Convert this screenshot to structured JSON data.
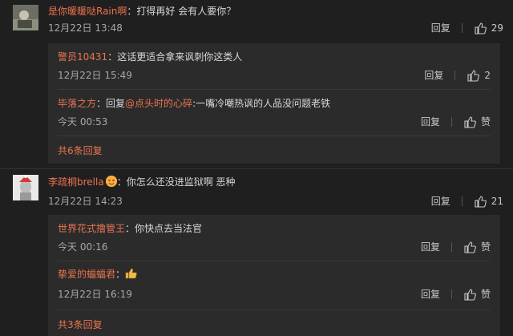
{
  "comments": [
    {
      "user": "是你暖暖哒Rain啊",
      "colon": "：",
      "text": "打得再好 会有人要你？",
      "time": "12月22日 13:48",
      "reply_label": "回复",
      "likes": "29",
      "avatar_icon": "user-avatar-photo",
      "replies": [
        {
          "user": "警员10431",
          "colon": "：",
          "text": "这话更适合拿来讽刺你这类人",
          "time": "12月22日 15:49",
          "reply_label": "回复",
          "likes": "2"
        },
        {
          "user": "毕落之方",
          "colon": "：",
          "prefix": "回复",
          "mention": "@点头时的心碎",
          "text": ":一嘴冷嘲热讽的人品没问题老铁",
          "time": "今天 00:53",
          "reply_label": "回复",
          "likes": "赞"
        }
      ],
      "more_label": "共6条回复"
    },
    {
      "user": "李疏桐brella",
      "colon": "：",
      "text": "你怎么还没进监狱啊 恶种",
      "time": "12月22日 14:23",
      "reply_label": "回复",
      "likes": "21",
      "avatar_icon": "user-avatar-statue",
      "replies": [
        {
          "user": "世界花式撸管王",
          "colon": "：",
          "text": "你快点去当法官",
          "time": "今天 00:16",
          "reply_label": "回复",
          "likes": "赞"
        },
        {
          "user": "挚爱的蝠蝠君",
          "colon": "：",
          "text": "",
          "time": "12月22日 16:19",
          "reply_label": "回复",
          "likes": "赞"
        }
      ],
      "more_label": "共3条回复"
    }
  ],
  "colors": {
    "background": "#1f1f1f",
    "sub_background": "#2b2b2b",
    "username": "#eb7350",
    "text": "#d8d8d8",
    "meta": "#a8a8a8"
  }
}
